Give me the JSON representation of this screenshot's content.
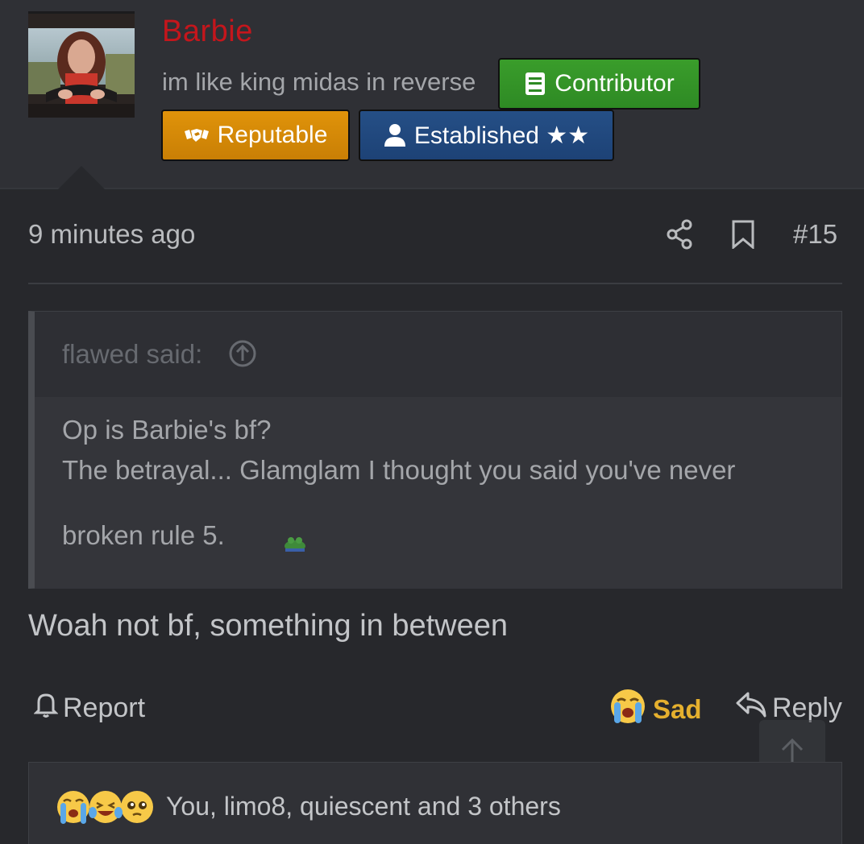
{
  "user": {
    "name": "Barbie",
    "title": "im like king midas in reverse",
    "name_color": "#c4161c",
    "badges": [
      {
        "label": "Contributor",
        "icon": "book-icon",
        "color": "#2e8a24"
      },
      {
        "label": "Reputable",
        "icon": "handshake-icon",
        "color": "#c97f05"
      },
      {
        "label": "Established ★★",
        "icon": "user-icon",
        "color": "#1d4276"
      }
    ]
  },
  "post": {
    "time": "9 minutes ago",
    "number": "#15",
    "icons": [
      "share-icon",
      "bookmark-icon"
    ]
  },
  "quote": {
    "author": "flawed said:",
    "lines": [
      "Op is Barbie's bf?",
      "The betrayal... Glamglam I thought you said you've never",
      "broken rule 5."
    ]
  },
  "message": "Woah not bf, something in between",
  "actions": {
    "report": "Report",
    "reaction": "Sad",
    "reaction_color": "#e5b02e",
    "reply": "Reply"
  },
  "reactions_summary": {
    "emojis": [
      "loudly-crying-emoji",
      "laughing-crying-emoji",
      "pleading-face-emoji"
    ],
    "text": "You, limo8, quiescent and 3 others"
  }
}
